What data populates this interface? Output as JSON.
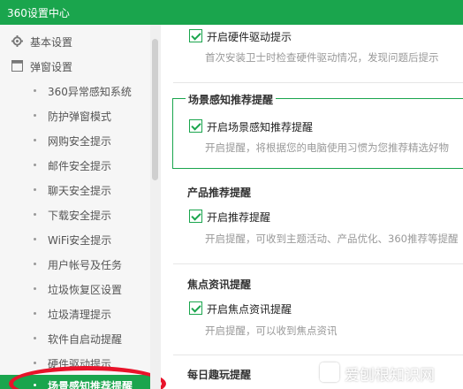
{
  "window": {
    "title": "360设置中心"
  },
  "sidebar": {
    "groups": [
      {
        "label": "基本设置",
        "icon": "gear-icon"
      },
      {
        "label": "弹窗设置",
        "icon": "window-icon"
      }
    ],
    "items": [
      {
        "label": "360异常感知系统"
      },
      {
        "label": "防护弹窗模式"
      },
      {
        "label": "网购安全提示"
      },
      {
        "label": "邮件安全提示"
      },
      {
        "label": "聊天安全提示"
      },
      {
        "label": "下载安全提示"
      },
      {
        "label": "WiFi安全提示"
      },
      {
        "label": "用户帐号及任务"
      },
      {
        "label": "垃圾恢复区设置"
      },
      {
        "label": "垃圾清理提示"
      },
      {
        "label": "软件自启动提醒"
      },
      {
        "label": "硬件驱动提示"
      },
      {
        "label": "场景感知推荐提醒"
      }
    ],
    "active_index": 12
  },
  "main": {
    "sections": [
      {
        "title": "",
        "option": "开启硬件驱动提示",
        "checked": true,
        "desc": "首次安装卫士时检查硬件驱动情况，发现问题后提示"
      },
      {
        "title": "场景感知推荐提醒",
        "option": "开启场景感知推荐提醒",
        "checked": true,
        "desc": "开启提醒，将根据您的电脑使用习惯为您推荐精选好物"
      },
      {
        "title": "产品推荐提醒",
        "option": "开启推荐提醒",
        "checked": true,
        "desc": "开启提醒，可收到主题活动、产品优化、360推荐等提醒"
      },
      {
        "title": "焦点资讯提醒",
        "option": "开启焦点资讯提醒",
        "checked": true,
        "desc": "开启提醒，可以收到焦点资讯"
      },
      {
        "title": "每日趣玩提醒",
        "option": "",
        "checked": false,
        "desc": ""
      }
    ]
  },
  "watermark": {
    "text": "爱刨根知识网"
  },
  "colors": {
    "accent": "#1aa54d",
    "highlight_circle": "#e8132a"
  }
}
